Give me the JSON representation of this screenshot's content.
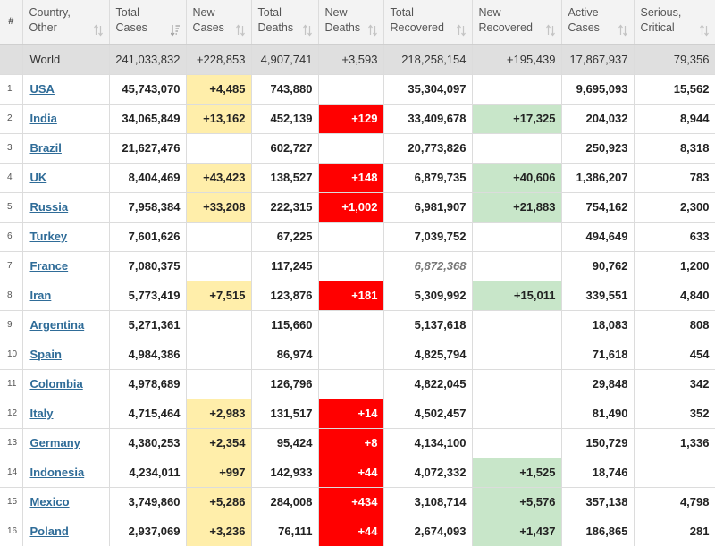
{
  "headers": [
    {
      "line1": "#",
      "line2": ""
    },
    {
      "line1": "Country,",
      "line2": "Other"
    },
    {
      "line1": "Total",
      "line2": "Cases"
    },
    {
      "line1": "New",
      "line2": "Cases"
    },
    {
      "line1": "Total",
      "line2": "Deaths"
    },
    {
      "line1": "New",
      "line2": "Deaths"
    },
    {
      "line1": "Total",
      "line2": "Recovered"
    },
    {
      "line1": "New",
      "line2": "Recovered"
    },
    {
      "line1": "Active",
      "line2": "Cases"
    },
    {
      "line1": "Serious,",
      "line2": "Critical"
    }
  ],
  "world": {
    "country": "World",
    "total_cases": "241,033,832",
    "new_cases": "+228,853",
    "total_deaths": "4,907,741",
    "new_deaths": "+3,593",
    "total_recovered": "218,258,154",
    "new_recovered": "+195,439",
    "active_cases": "17,867,937",
    "serious_critical": "79,356"
  },
  "rows": [
    {
      "num": "1",
      "country": "USA",
      "total_cases": "45,743,070",
      "new_cases": "+4,485",
      "total_deaths": "743,880",
      "new_deaths": "",
      "total_recovered": "35,304,097",
      "new_recovered": "",
      "active_cases": "9,695,093",
      "serious_critical": "15,562"
    },
    {
      "num": "2",
      "country": "India",
      "total_cases": "34,065,849",
      "new_cases": "+13,162",
      "total_deaths": "452,139",
      "new_deaths": "+129",
      "total_recovered": "33,409,678",
      "new_recovered": "+17,325",
      "active_cases": "204,032",
      "serious_critical": "8,944"
    },
    {
      "num": "3",
      "country": "Brazil",
      "total_cases": "21,627,476",
      "new_cases": "",
      "total_deaths": "602,727",
      "new_deaths": "",
      "total_recovered": "20,773,826",
      "new_recovered": "",
      "active_cases": "250,923",
      "serious_critical": "8,318"
    },
    {
      "num": "4",
      "country": "UK",
      "total_cases": "8,404,469",
      "new_cases": "+43,423",
      "total_deaths": "138,527",
      "new_deaths": "+148",
      "total_recovered": "6,879,735",
      "new_recovered": "+40,606",
      "active_cases": "1,386,207",
      "serious_critical": "783"
    },
    {
      "num": "5",
      "country": "Russia",
      "total_cases": "7,958,384",
      "new_cases": "+33,208",
      "total_deaths": "222,315",
      "new_deaths": "+1,002",
      "total_recovered": "6,981,907",
      "new_recovered": "+21,883",
      "active_cases": "754,162",
      "serious_critical": "2,300"
    },
    {
      "num": "6",
      "country": "Turkey",
      "total_cases": "7,601,626",
      "new_cases": "",
      "total_deaths": "67,225",
      "new_deaths": "",
      "total_recovered": "7,039,752",
      "new_recovered": "",
      "active_cases": "494,649",
      "serious_critical": "633"
    },
    {
      "num": "7",
      "country": "France",
      "total_cases": "7,080,375",
      "new_cases": "",
      "total_deaths": "117,245",
      "new_deaths": "",
      "total_recovered": "6,872,368",
      "new_recovered": "",
      "active_cases": "90,762",
      "serious_critical": "1,200"
    },
    {
      "num": "8",
      "country": "Iran",
      "total_cases": "5,773,419",
      "new_cases": "+7,515",
      "total_deaths": "123,876",
      "new_deaths": "+181",
      "total_recovered": "5,309,992",
      "new_recovered": "+15,011",
      "active_cases": "339,551",
      "serious_critical": "4,840"
    },
    {
      "num": "9",
      "country": "Argentina",
      "total_cases": "5,271,361",
      "new_cases": "",
      "total_deaths": "115,660",
      "new_deaths": "",
      "total_recovered": "5,137,618",
      "new_recovered": "",
      "active_cases": "18,083",
      "serious_critical": "808"
    },
    {
      "num": "10",
      "country": "Spain",
      "total_cases": "4,984,386",
      "new_cases": "",
      "total_deaths": "86,974",
      "new_deaths": "",
      "total_recovered": "4,825,794",
      "new_recovered": "",
      "active_cases": "71,618",
      "serious_critical": "454"
    },
    {
      "num": "11",
      "country": "Colombia",
      "total_cases": "4,978,689",
      "new_cases": "",
      "total_deaths": "126,796",
      "new_deaths": "",
      "total_recovered": "4,822,045",
      "new_recovered": "",
      "active_cases": "29,848",
      "serious_critical": "342"
    },
    {
      "num": "12",
      "country": "Italy",
      "total_cases": "4,715,464",
      "new_cases": "+2,983",
      "total_deaths": "131,517",
      "new_deaths": "+14",
      "total_recovered": "4,502,457",
      "new_recovered": "",
      "active_cases": "81,490",
      "serious_critical": "352"
    },
    {
      "num": "13",
      "country": "Germany",
      "total_cases": "4,380,253",
      "new_cases": "+2,354",
      "total_deaths": "95,424",
      "new_deaths": "+8",
      "total_recovered": "4,134,100",
      "new_recovered": "",
      "active_cases": "150,729",
      "serious_critical": "1,336"
    },
    {
      "num": "14",
      "country": "Indonesia",
      "total_cases": "4,234,011",
      "new_cases": "+997",
      "total_deaths": "142,933",
      "new_deaths": "+44",
      "total_recovered": "4,072,332",
      "new_recovered": "+1,525",
      "active_cases": "18,746",
      "serious_critical": ""
    },
    {
      "num": "15",
      "country": "Mexico",
      "total_cases": "3,749,860",
      "new_cases": "+5,286",
      "total_deaths": "284,008",
      "new_deaths": "+434",
      "total_recovered": "3,108,714",
      "new_recovered": "+5,576",
      "active_cases": "357,138",
      "serious_critical": "4,798"
    },
    {
      "num": "16",
      "country": "Poland",
      "total_cases": "2,937,069",
      "new_cases": "+3,236",
      "total_deaths": "76,111",
      "new_deaths": "+44",
      "total_recovered": "2,674,093",
      "new_recovered": "+1,437",
      "active_cases": "186,865",
      "serious_critical": "281"
    }
  ],
  "colors": {
    "new_cases_highlight": "#ffeeaa",
    "new_deaths_highlight": "#ff0000",
    "new_recovered_highlight": "#c8e6c9",
    "link": "#2f6c98",
    "world_row": "#dfdfdf"
  },
  "icons": {
    "sort": "sort-arrows-icon",
    "sort_active": "sort-descending-icon"
  }
}
